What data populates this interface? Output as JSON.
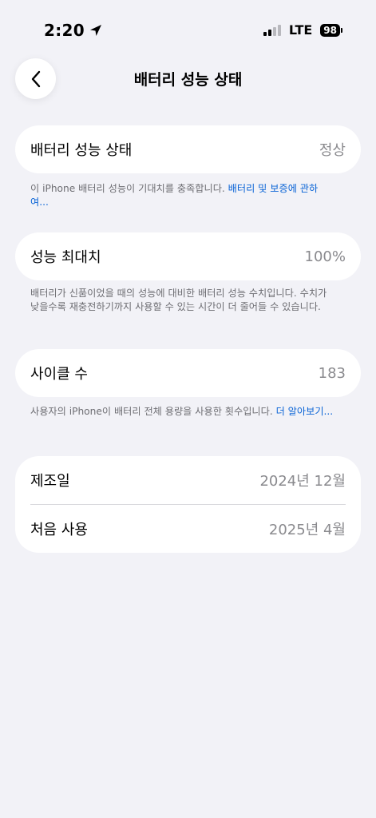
{
  "status_bar": {
    "time": "2:20",
    "network": "LTE",
    "battery_level": "98"
  },
  "nav": {
    "title": "배터리 성능 상태"
  },
  "health_card": {
    "label": "배터리 성능 상태",
    "value": "정상"
  },
  "health_note": {
    "text": "이 iPhone 배터리 성능이 기대치를 충족합니다. ",
    "link": "배터리 및 보증에 관하여..."
  },
  "capacity_card": {
    "label": "성능 최대치",
    "value": "100%"
  },
  "capacity_note": {
    "text": "배터리가 신품이었을 때의 성능에 대비한 배터리 성능 수치입니다. 수치가 낮을수록 재충전하기까지 사용할 수 있는 시간이 더 줄어들 수 있습니다."
  },
  "cycle_card": {
    "label": "사이클 수",
    "value": "183"
  },
  "cycle_note": {
    "text": "사용자의 iPhone이 배터리 전체 용량을 사용한 횟수입니다. ",
    "link": "더 알아보기..."
  },
  "dates_card": {
    "rows": [
      {
        "label": "제조일",
        "value": "2024년 12월"
      },
      {
        "label": "처음 사용",
        "value": "2025년 4월"
      }
    ]
  }
}
